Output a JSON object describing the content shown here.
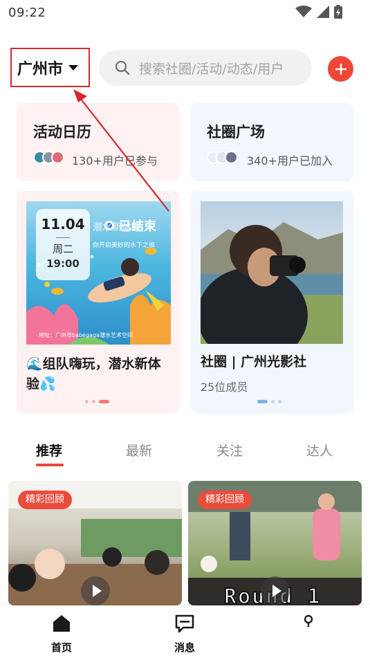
{
  "status_bar": {
    "time": "09:22",
    "icons": [
      "wifi-icon",
      "signal-icon",
      "battery-icon"
    ]
  },
  "header": {
    "city": "广州市",
    "search_placeholder": "搜索社圈/活动/动态/用户",
    "add_icon": "plus-icon",
    "accent_color": "#ef4637"
  },
  "quick_entries": [
    {
      "title": "活动日历",
      "subtitle": "130+用户已参与"
    },
    {
      "title": "社圈广场",
      "subtitle": "340+用户已加入"
    }
  ],
  "featured_activity": {
    "poster": {
      "date": "11.04",
      "weekday": "周二",
      "time": "19:00",
      "status": "已结束",
      "headline": "潜水新体验",
      "tagline": "你开启美妙的水下之旅",
      "address": "地址：广州市babegaga潜水艺术空间"
    },
    "title": "🌊组队嗨玩，潜水新体验💦"
  },
  "featured_circle": {
    "title": "社圈 | 广州光影社",
    "members": "25位成员"
  },
  "tabs": [
    "推荐",
    "最新",
    "关注",
    "达人"
  ],
  "active_tab": "推荐",
  "feed": [
    {
      "badge": "精彩回顾"
    },
    {
      "badge": "精彩回顾",
      "overlay_text": "Round 1"
    }
  ],
  "bottom_nav": [
    {
      "label": "首页",
      "icon": "home-icon"
    },
    {
      "label": "消息",
      "icon": "message-icon"
    },
    {
      "label": "",
      "icon": "location-icon"
    }
  ]
}
